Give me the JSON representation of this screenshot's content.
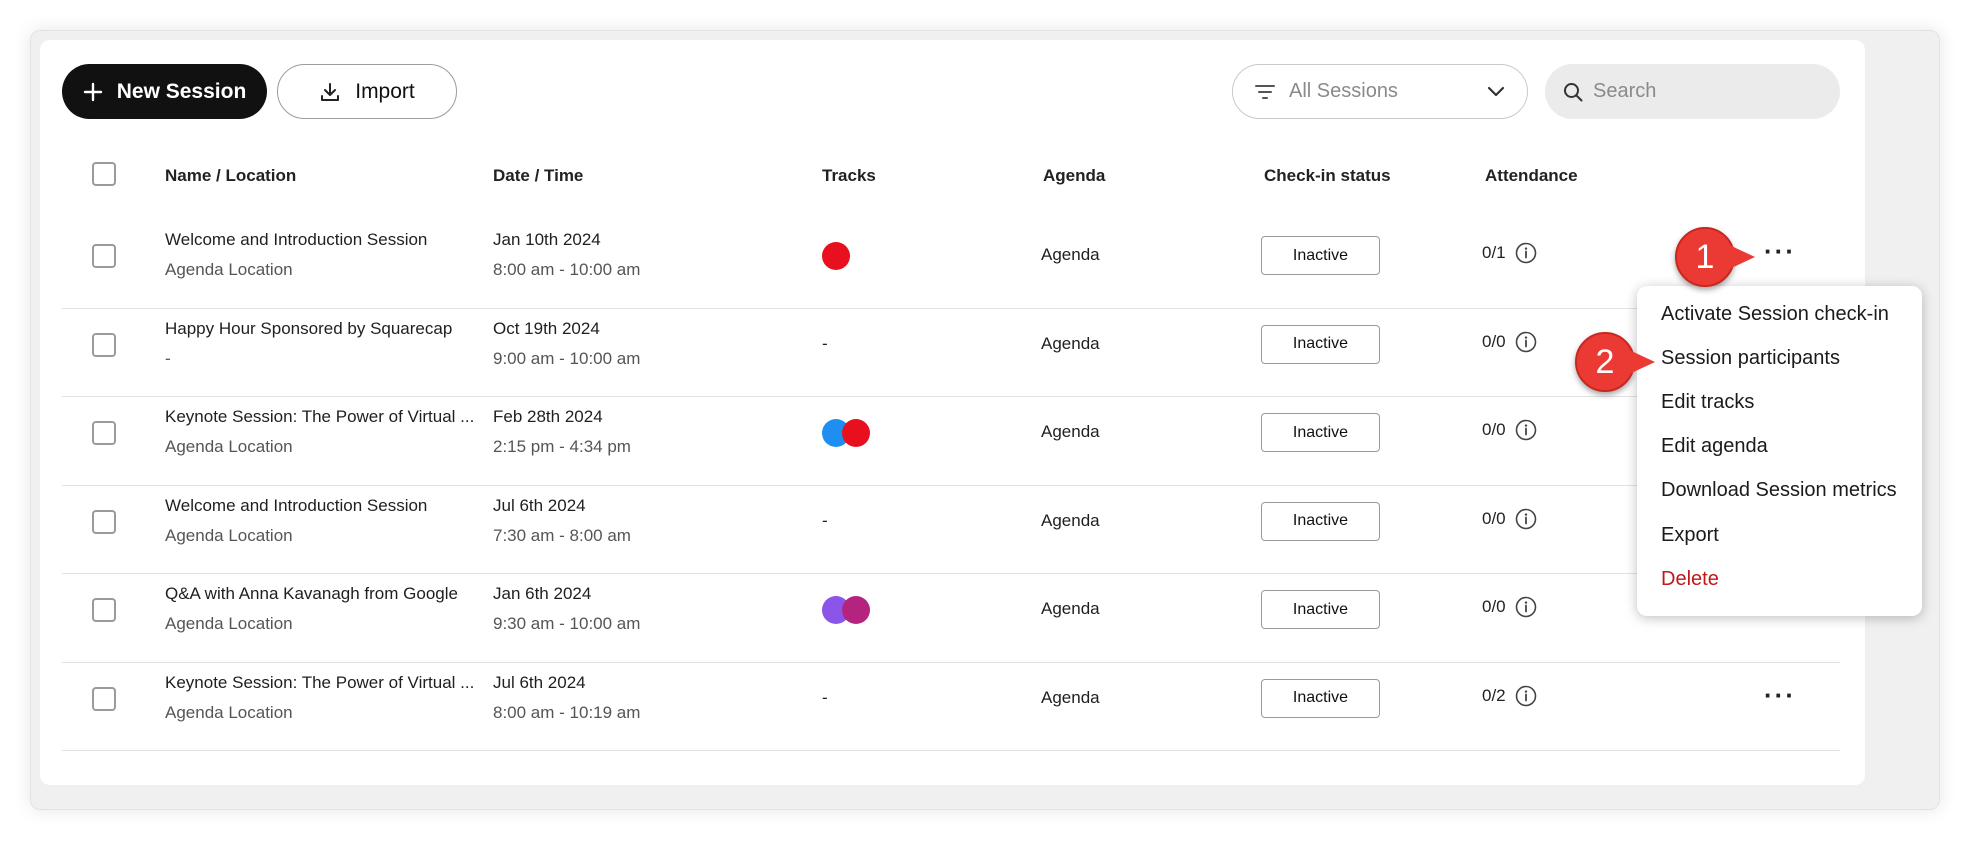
{
  "toolbar": {
    "new_session_label": "New Session",
    "import_label": "Import",
    "filter_value": "All Sessions",
    "search_placeholder": "Search"
  },
  "table": {
    "headers": {
      "name": "Name / Location",
      "date": "Date / Time",
      "tracks": "Tracks",
      "agenda": "Agenda",
      "checkin": "Check-in status",
      "attendance": "Attendance"
    },
    "rows": [
      {
        "name": "Welcome and Introduction Session",
        "location": "Agenda Location",
        "date": "Jan 10th 2024",
        "time": "8:00 am - 10:00 am",
        "tracks": [
          "#e8101f"
        ],
        "tracks_text": "",
        "agenda": "Agenda",
        "status": "Inactive",
        "attendance": "0/1"
      },
      {
        "name": "Happy Hour Sponsored by Squarecap",
        "location": "-",
        "date": "Oct 19th 2024",
        "time": "9:00 am - 10:00 am",
        "tracks": [],
        "tracks_text": "-",
        "agenda": "Agenda",
        "status": "Inactive",
        "attendance": "0/0"
      },
      {
        "name": "Keynote Session: The Power of Virtual ...",
        "location": "Agenda Location",
        "date": "Feb 28th 2024",
        "time": "2:15 pm - 4:34 pm",
        "tracks": [
          "#1e8ef0",
          "#e8101f"
        ],
        "tracks_text": "",
        "agenda": "Agenda",
        "status": "Inactive",
        "attendance": "0/0"
      },
      {
        "name": "Welcome and Introduction Session",
        "location": "Agenda Location",
        "date": "Jul 6th 2024",
        "time": "7:30 am - 8:00 am",
        "tracks": [],
        "tracks_text": "-",
        "agenda": "Agenda",
        "status": "Inactive",
        "attendance": "0/0"
      },
      {
        "name": "Q&A with Anna Kavanagh from Google",
        "location": "Agenda Location",
        "date": "Jan 6th 2024",
        "time": "9:30 am - 10:00 am",
        "tracks": [
          "#8a55e8",
          "#b4247e"
        ],
        "tracks_text": "",
        "agenda": "Agenda",
        "status": "Inactive",
        "attendance": "0/0"
      },
      {
        "name": "Keynote Session: The Power of Virtual ...",
        "location": "Agenda Location",
        "date": "Jul 6th 2024",
        "time": "8:00 am - 10:19 am",
        "tracks": [],
        "tracks_text": "-",
        "agenda": "Agenda",
        "status": "Inactive",
        "attendance": "0/2"
      }
    ]
  },
  "menu": {
    "items": [
      "Activate Session check-in",
      "Session participants",
      "Edit tracks",
      "Edit agenda",
      "Download Session metrics",
      "Export",
      "Delete"
    ]
  },
  "callouts": [
    "1",
    "2"
  ],
  "colors": {
    "danger": "#c01818",
    "callout": "#ea3a33",
    "primary_button": "#111111"
  }
}
